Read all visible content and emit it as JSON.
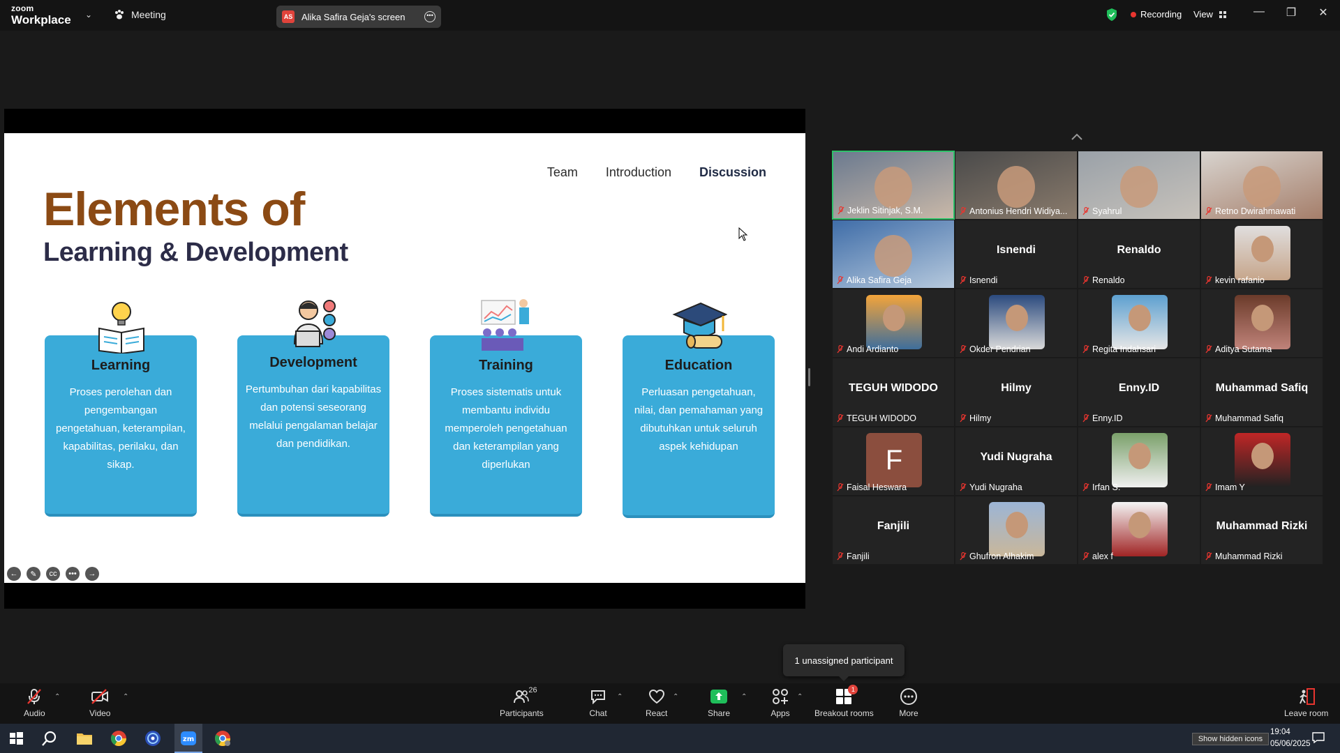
{
  "titlebar": {
    "brand_top": "zoom",
    "brand_bottom": "Workplace",
    "meeting_label": "Meeting",
    "screen_share_label": "Alika Safira Geja's screen",
    "screen_share_initials": "AS",
    "recording_label": "Recording",
    "view_label": "View"
  },
  "slide": {
    "nav": [
      "Team",
      "Introduction",
      "Discussion"
    ],
    "title_line1": "Elements of",
    "title_line2": "Learning & Development",
    "cards": [
      {
        "title": "Learning",
        "desc": "Proses perolehan dan pengembangan pengetahuan, keterampilan, kapabilitas, perilaku, dan sikap."
      },
      {
        "title": "Development",
        "desc": "Pertumbuhan dari kapabilitas dan potensi seseorang melalui pengalaman belajar dan pendidikan."
      },
      {
        "title": "Training",
        "desc": "Proses sistematis untuk membantu individu memperoleh pengetahuan dan keterampilan yang diperlukan"
      },
      {
        "title": "Education",
        "desc": "Perluasan pengetahuan, nilai, dan pemahaman yang dibutuhkan untuk seluruh aspek kehidupan"
      }
    ]
  },
  "participants": [
    {
      "name": "Jeklin Sitinjak, S.M.",
      "kind": "video",
      "active": true
    },
    {
      "name": "Antonius Hendri Widiya...",
      "kind": "video"
    },
    {
      "name": "Syahrul",
      "kind": "video"
    },
    {
      "name": "Retno Dwirahmawati",
      "kind": "video"
    },
    {
      "name": "Alika Safira Geja",
      "kind": "video"
    },
    {
      "name": "Isnendi",
      "kind": "name",
      "center": "Isnendi"
    },
    {
      "name": "Renaldo",
      "kind": "name",
      "center": "Renaldo"
    },
    {
      "name": "kevin rafanio",
      "kind": "photo"
    },
    {
      "name": "Andi Ardianto",
      "kind": "photo"
    },
    {
      "name": "Okder Pendrian",
      "kind": "photo"
    },
    {
      "name": "Regita Indahsari",
      "kind": "photo"
    },
    {
      "name": "Aditya Sutama",
      "kind": "photo"
    },
    {
      "name": "TEGUH WIDODO",
      "kind": "name",
      "center": "TEGUH WIDODO"
    },
    {
      "name": "Hilmy",
      "kind": "name",
      "center": "Hilmy"
    },
    {
      "name": "Enny.ID",
      "kind": "name",
      "center": "Enny.ID"
    },
    {
      "name": "Muhammad Safiq",
      "kind": "name",
      "center": "Muhammad Safiq"
    },
    {
      "name": "Faisal Heswara",
      "kind": "letter",
      "letter": "F"
    },
    {
      "name": "Yudi  Nugraha",
      "kind": "name",
      "center": "Yudi  Nugraha"
    },
    {
      "name": "Irfan S.",
      "kind": "photo"
    },
    {
      "name": "Imam Y",
      "kind": "photo"
    },
    {
      "name": "Fanjili",
      "kind": "name",
      "center": "Fanjili"
    },
    {
      "name": "Ghufron Alhakim",
      "kind": "photo"
    },
    {
      "name": "alex  f",
      "kind": "photo"
    },
    {
      "name": "Muhammad Rizki",
      "kind": "name",
      "center": "Muhammad Rizki"
    }
  ],
  "tooltip": "1 unassigned participant",
  "toolbar": {
    "audio": "Audio",
    "video": "Video",
    "participants": "Participants",
    "participants_count": "26",
    "chat": "Chat",
    "react": "React",
    "share": "Share",
    "apps": "Apps",
    "breakout": "Breakout rooms",
    "breakout_badge": "1",
    "more": "More",
    "leave": "Leave room"
  },
  "taskbar": {
    "hidden_icons": "Show hidden icons",
    "time": "19:04",
    "date": "05/06/2025"
  },
  "colors": {
    "slide_title_brown": "#8b4a14",
    "card_blue": "#3aabd9",
    "share_green": "#1fbe5a",
    "recording_red": "#e8352f",
    "active_speaker": "#2ec26a"
  }
}
